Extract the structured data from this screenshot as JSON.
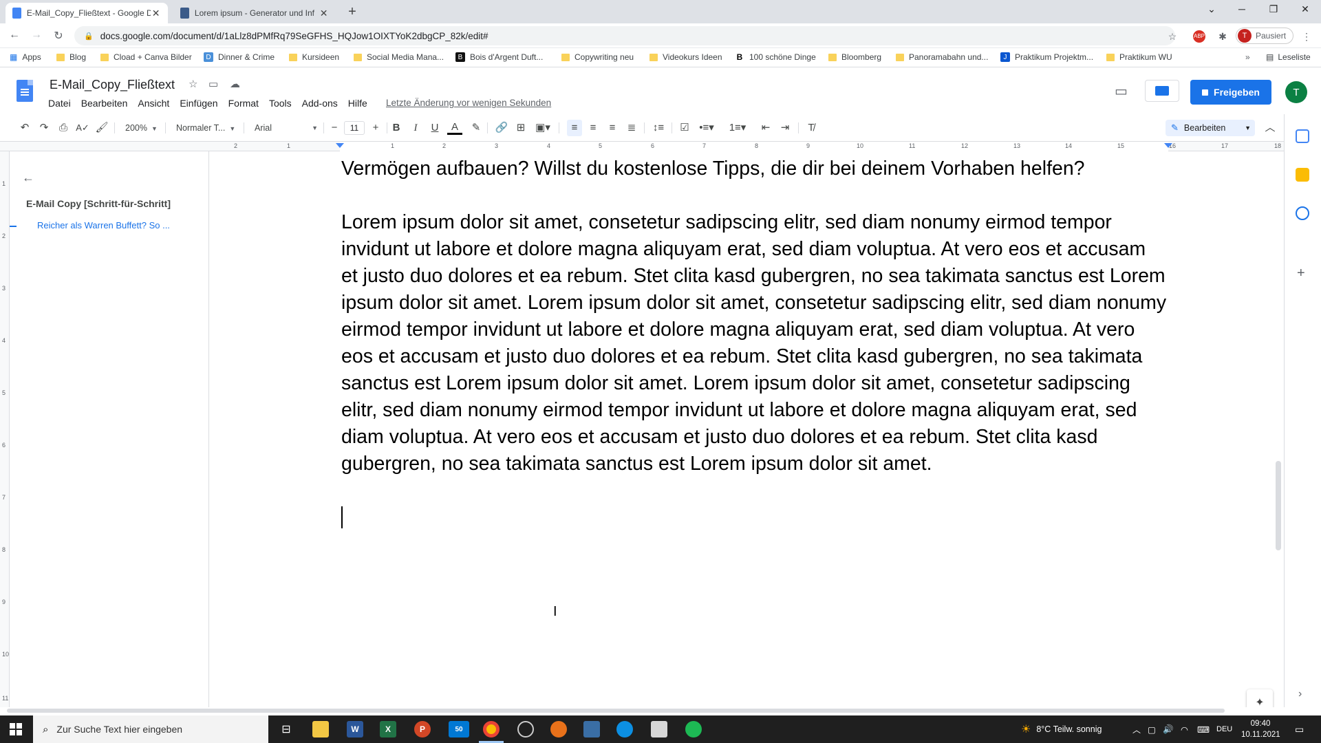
{
  "browser": {
    "tabs": [
      {
        "title": "E-Mail_Copy_Fließtext - Google D",
        "active": true
      },
      {
        "title": "Lorem ipsum - Generator und Inf",
        "active": false
      }
    ],
    "url": "docs.google.com/document/d/1aLlz8dPMfRq79SeGFHS_HQJow1OIXTYoK2dbgCP_82k/edit#",
    "profile_label": "Pausiert",
    "profile_initial": "T",
    "bookmarks": [
      "Apps",
      "Blog",
      "Cload + Canva Bilder",
      "Dinner & Crime",
      "Kursideen",
      "Social Media Mana...",
      "Bois d'Argent Duft...",
      "Copywriting neu",
      "Videokurs Ideen",
      "100 schöne Dinge",
      "Bloomberg",
      "Panoramabahn und...",
      "Praktikum Projektm...",
      "Praktikum WU"
    ],
    "reading_list": "Leseliste"
  },
  "docs": {
    "title": "E-Mail_Copy_Fließtext",
    "menu": [
      "Datei",
      "Bearbeiten",
      "Ansicht",
      "Einfügen",
      "Format",
      "Tools",
      "Add-ons",
      "Hilfe"
    ],
    "last_edit": "Letzte Änderung vor wenigen Sekunden",
    "share_label": "Freigeben",
    "user_initial": "T",
    "toolbar": {
      "zoom": "200%",
      "style": "Normaler T...",
      "font": "Arial",
      "font_size": "11",
      "mode": "Bearbeiten"
    },
    "ruler_numbers": [
      "2",
      "1",
      "1",
      "2",
      "3",
      "4",
      "5",
      "6",
      "7",
      "8",
      "9",
      "10",
      "11",
      "12",
      "13",
      "14",
      "15",
      "16",
      "17",
      "18"
    ],
    "vruler_numbers": [
      "1",
      "2",
      "3",
      "4",
      "5",
      "6",
      "7",
      "8",
      "9",
      "10",
      "11"
    ],
    "outline": {
      "heading": "E-Mail Copy [Schritt-für-Schritt]",
      "item": "Reicher als Warren Buffett? So ..."
    },
    "body": {
      "line1": "Vermögen aufbauen? Willst du kostenlose Tipps, die dir bei deinem Vorhaben helfen?",
      "paragraph": "Lorem ipsum dolor sit amet, consetetur sadipscing elitr, sed diam nonumy eirmod tempor invidunt ut labore et dolore magna aliquyam erat, sed diam voluptua. At vero eos et accusam et justo duo dolores et ea rebum. Stet clita kasd gubergren, no sea takimata sanctus est Lorem ipsum dolor sit amet. Lorem ipsum dolor sit amet, consetetur sadipscing elitr, sed diam nonumy eirmod tempor invidunt ut labore et dolore magna aliquyam erat, sed diam voluptua. At vero eos et accusam et justo duo dolores et ea rebum. Stet clita kasd gubergren, no sea takimata sanctus est Lorem ipsum dolor sit amet. Lorem ipsum dolor sit amet, consetetur sadipscing elitr, sed diam nonumy eirmod tempor invidunt ut labore et dolore magna aliquyam erat, sed diam voluptua. At vero eos et accusam et justo duo dolores et ea rebum. Stet clita kasd gubergren, no sea takimata sanctus est Lorem ipsum dolor sit amet."
    }
  },
  "taskbar": {
    "search_placeholder": "Zur Suche Text hier eingeben",
    "mail_badge": "50",
    "weather": "8°C  Teilw. sonnig",
    "language": "DEU",
    "time": "09:40",
    "date": "10.11.2021"
  },
  "colors": {
    "accent": "#1a73e8",
    "docs_blue": "#4285f4",
    "taskbar": "#1f1f1f"
  }
}
